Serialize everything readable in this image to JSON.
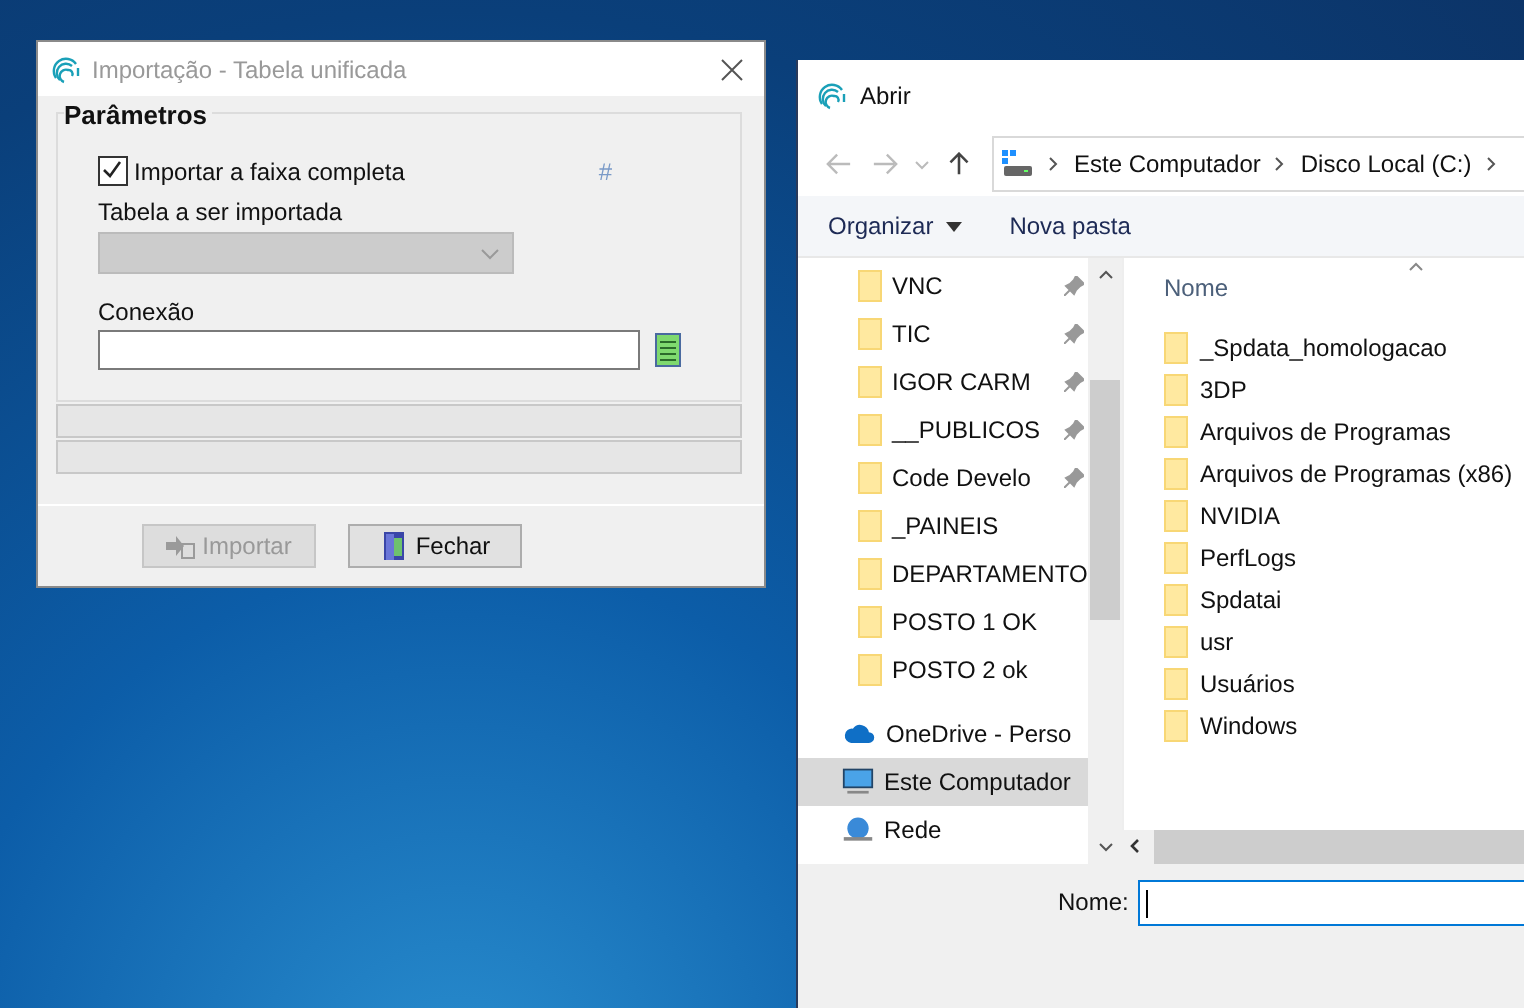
{
  "import_window": {
    "title": "Importação - Tabela unificada",
    "group_title": "Parâmetros",
    "full_range": {
      "label": "Importar a faixa completa",
      "checked": true
    },
    "hash_mark": "#",
    "table_label": "Tabela a ser importada",
    "table_combo": {
      "disabled": true
    },
    "connection_label": "Conexão",
    "progress_bars": [
      {
        "level": 0
      },
      {
        "level": 0
      }
    ],
    "buttons": [
      {
        "label": "Importar",
        "kind": "import",
        "disabled": true
      },
      {
        "label": "Fechar",
        "kind": "close",
        "disabled": false
      }
    ]
  },
  "open_window": {
    "title": "Abrir",
    "breadcrumb": [
      "Este Computador",
      "Disco Local (C:)"
    ],
    "toolbar": [
      {
        "label": "Organizar",
        "kind": "menu"
      },
      {
        "label": "Nova pasta",
        "kind": "plain"
      }
    ],
    "nav_items": [
      {
        "label": "VNC",
        "kind": "folder",
        "pinned": true,
        "selected": false
      },
      {
        "label": "TIC",
        "kind": "folder",
        "pinned": true,
        "selected": false
      },
      {
        "label": "IGOR CARM",
        "kind": "folder",
        "pinned": true,
        "selected": false
      },
      {
        "label": "__PUBLICOS",
        "kind": "folder",
        "pinned": true,
        "selected": false
      },
      {
        "label": "Code Develo",
        "kind": "folder",
        "pinned": true,
        "selected": false
      },
      {
        "label": "_PAINEIS",
        "kind": "folder",
        "pinned": false,
        "selected": false
      },
      {
        "label": "DEPARTAMENTO",
        "kind": "folder",
        "pinned": false,
        "selected": false
      },
      {
        "label": "POSTO 1 OK",
        "kind": "folder",
        "pinned": false,
        "selected": false
      },
      {
        "label": "POSTO 2 ok",
        "kind": "folder",
        "pinned": false,
        "selected": false
      },
      {
        "label": "OneDrive - Perso",
        "kind": "cloud",
        "pinned": false,
        "selected": false
      },
      {
        "label": "Este Computador",
        "kind": "computer",
        "pinned": false,
        "selected": true
      },
      {
        "label": "Rede",
        "kind": "network",
        "pinned": false,
        "selected": false
      }
    ],
    "column_header": "Nome",
    "files": [
      "_Spdata_homologacao",
      "3DP",
      "Arquivos de Programas",
      "Arquivos de Programas (x86)",
      "NVIDIA",
      "PerfLogs",
      "Spdatai",
      "usr",
      "Usuários",
      "Windows"
    ],
    "name_label": "Nome:"
  }
}
